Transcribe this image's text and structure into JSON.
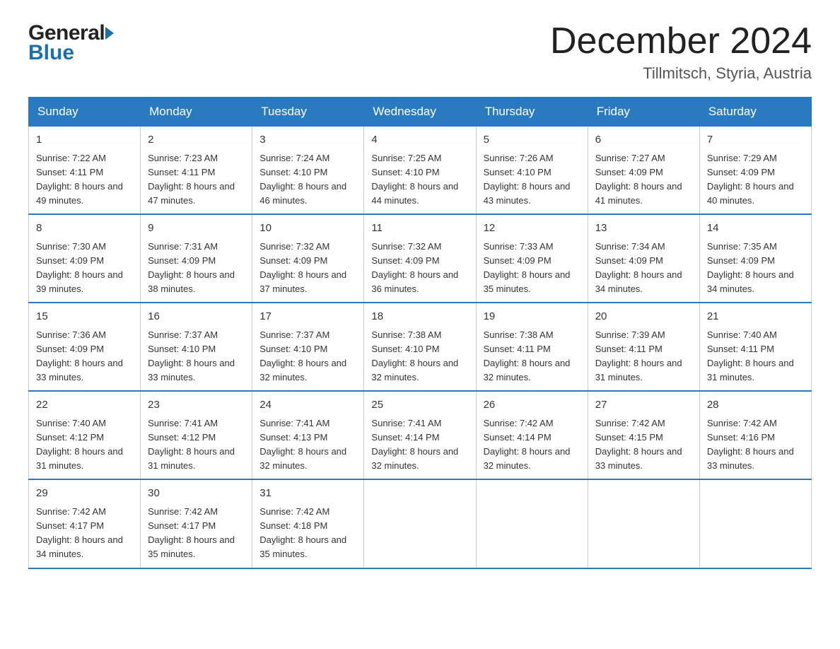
{
  "header": {
    "logo_line1": "General",
    "logo_line2": "Blue",
    "month_title": "December 2024",
    "location": "Tillmitsch, Styria, Austria"
  },
  "days_of_week": [
    "Sunday",
    "Monday",
    "Tuesday",
    "Wednesday",
    "Thursday",
    "Friday",
    "Saturday"
  ],
  "weeks": [
    [
      {
        "day": "1",
        "sunrise": "7:22 AM",
        "sunset": "4:11 PM",
        "daylight": "8 hours and 49 minutes."
      },
      {
        "day": "2",
        "sunrise": "7:23 AM",
        "sunset": "4:11 PM",
        "daylight": "8 hours and 47 minutes."
      },
      {
        "day": "3",
        "sunrise": "7:24 AM",
        "sunset": "4:10 PM",
        "daylight": "8 hours and 46 minutes."
      },
      {
        "day": "4",
        "sunrise": "7:25 AM",
        "sunset": "4:10 PM",
        "daylight": "8 hours and 44 minutes."
      },
      {
        "day": "5",
        "sunrise": "7:26 AM",
        "sunset": "4:10 PM",
        "daylight": "8 hours and 43 minutes."
      },
      {
        "day": "6",
        "sunrise": "7:27 AM",
        "sunset": "4:09 PM",
        "daylight": "8 hours and 41 minutes."
      },
      {
        "day": "7",
        "sunrise": "7:29 AM",
        "sunset": "4:09 PM",
        "daylight": "8 hours and 40 minutes."
      }
    ],
    [
      {
        "day": "8",
        "sunrise": "7:30 AM",
        "sunset": "4:09 PM",
        "daylight": "8 hours and 39 minutes."
      },
      {
        "day": "9",
        "sunrise": "7:31 AM",
        "sunset": "4:09 PM",
        "daylight": "8 hours and 38 minutes."
      },
      {
        "day": "10",
        "sunrise": "7:32 AM",
        "sunset": "4:09 PM",
        "daylight": "8 hours and 37 minutes."
      },
      {
        "day": "11",
        "sunrise": "7:32 AM",
        "sunset": "4:09 PM",
        "daylight": "8 hours and 36 minutes."
      },
      {
        "day": "12",
        "sunrise": "7:33 AM",
        "sunset": "4:09 PM",
        "daylight": "8 hours and 35 minutes."
      },
      {
        "day": "13",
        "sunrise": "7:34 AM",
        "sunset": "4:09 PM",
        "daylight": "8 hours and 34 minutes."
      },
      {
        "day": "14",
        "sunrise": "7:35 AM",
        "sunset": "4:09 PM",
        "daylight": "8 hours and 34 minutes."
      }
    ],
    [
      {
        "day": "15",
        "sunrise": "7:36 AM",
        "sunset": "4:09 PM",
        "daylight": "8 hours and 33 minutes."
      },
      {
        "day": "16",
        "sunrise": "7:37 AM",
        "sunset": "4:10 PM",
        "daylight": "8 hours and 33 minutes."
      },
      {
        "day": "17",
        "sunrise": "7:37 AM",
        "sunset": "4:10 PM",
        "daylight": "8 hours and 32 minutes."
      },
      {
        "day": "18",
        "sunrise": "7:38 AM",
        "sunset": "4:10 PM",
        "daylight": "8 hours and 32 minutes."
      },
      {
        "day": "19",
        "sunrise": "7:38 AM",
        "sunset": "4:11 PM",
        "daylight": "8 hours and 32 minutes."
      },
      {
        "day": "20",
        "sunrise": "7:39 AM",
        "sunset": "4:11 PM",
        "daylight": "8 hours and 31 minutes."
      },
      {
        "day": "21",
        "sunrise": "7:40 AM",
        "sunset": "4:11 PM",
        "daylight": "8 hours and 31 minutes."
      }
    ],
    [
      {
        "day": "22",
        "sunrise": "7:40 AM",
        "sunset": "4:12 PM",
        "daylight": "8 hours and 31 minutes."
      },
      {
        "day": "23",
        "sunrise": "7:41 AM",
        "sunset": "4:12 PM",
        "daylight": "8 hours and 31 minutes."
      },
      {
        "day": "24",
        "sunrise": "7:41 AM",
        "sunset": "4:13 PM",
        "daylight": "8 hours and 32 minutes."
      },
      {
        "day": "25",
        "sunrise": "7:41 AM",
        "sunset": "4:14 PM",
        "daylight": "8 hours and 32 minutes."
      },
      {
        "day": "26",
        "sunrise": "7:42 AM",
        "sunset": "4:14 PM",
        "daylight": "8 hours and 32 minutes."
      },
      {
        "day": "27",
        "sunrise": "7:42 AM",
        "sunset": "4:15 PM",
        "daylight": "8 hours and 33 minutes."
      },
      {
        "day": "28",
        "sunrise": "7:42 AM",
        "sunset": "4:16 PM",
        "daylight": "8 hours and 33 minutes."
      }
    ],
    [
      {
        "day": "29",
        "sunrise": "7:42 AM",
        "sunset": "4:17 PM",
        "daylight": "8 hours and 34 minutes."
      },
      {
        "day": "30",
        "sunrise": "7:42 AM",
        "sunset": "4:17 PM",
        "daylight": "8 hours and 35 minutes."
      },
      {
        "day": "31",
        "sunrise": "7:42 AM",
        "sunset": "4:18 PM",
        "daylight": "8 hours and 35 minutes."
      },
      null,
      null,
      null,
      null
    ]
  ]
}
